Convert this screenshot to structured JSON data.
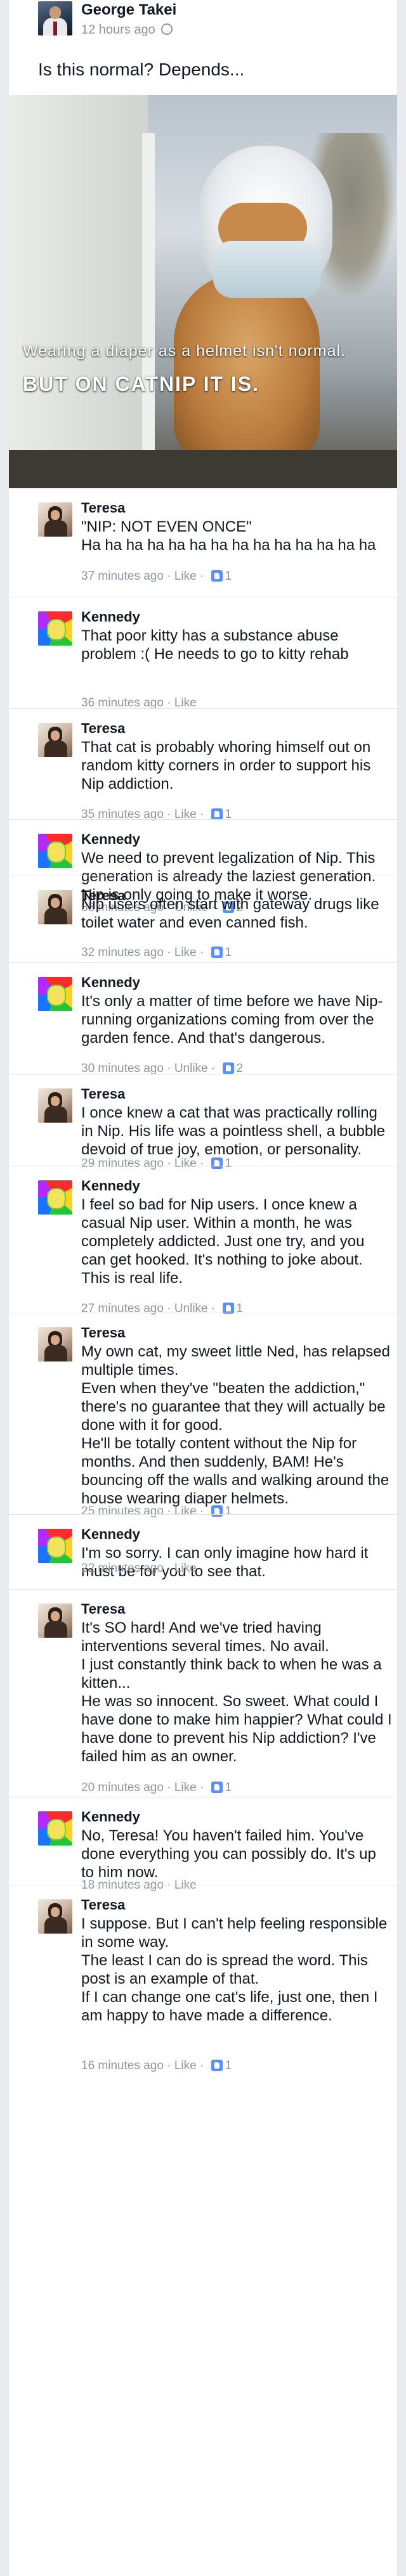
{
  "post": {
    "author": "George Takei",
    "time": "12 hours ago",
    "globe_icon": "globe-icon",
    "text": "Is this normal? Depends...",
    "image_caption_1": "Wearing a diaper as a helmet isn't normal.",
    "image_caption_2": "BUT ON CATNIP IT IS."
  },
  "comments": [
    {
      "author": "Teresa",
      "text": "\"NIP: NOT EVEN ONCE\"\nHa ha ha ha ha ha ha ha ha ha ha ha ha ha",
      "time": "37 minutes ago",
      "action": "Like",
      "likes": "1"
    },
    {
      "author": "Kennedy",
      "text": "That poor kitty has a substance abuse problem :( He needs to go to kitty rehab",
      "time": "36 minutes ago",
      "action": "Like",
      "likes": ""
    },
    {
      "author": "Teresa",
      "text": "That cat is probably whoring himself out on random kitty corners in order to support his Nip addiction.",
      "time": "35 minutes ago",
      "action": "Like",
      "likes": "1"
    },
    {
      "author": "Kennedy",
      "text": "We need to prevent legalization of Nip. This generation is already the laziest generation. Nip is only going to make it worse.",
      "time": "33 minutes ago",
      "action": "Unlike",
      "likes": "2"
    },
    {
      "author": "Teresa",
      "text": "Nip users often start with gateway drugs like toilet water and even canned fish.",
      "time": "32 minutes ago",
      "action": "Like",
      "likes": "1"
    },
    {
      "author": "Kennedy",
      "text": "It's only a matter of time before we have Nip-running organizations coming from over the garden fence. And that's dangerous.",
      "time": "30 minutes ago",
      "action": "Unlike",
      "likes": "2"
    },
    {
      "author": "Teresa",
      "text": "I once knew a cat that was practically rolling in Nip. His life was a pointless shell, a bubble devoid of true joy, emotion, or personality.",
      "time": "29 minutes ago",
      "action": "Like",
      "likes": "1"
    },
    {
      "author": "Kennedy",
      "text": "I feel so bad for Nip users. I once knew a casual Nip user. Within a month, he was completely addicted. Just one try, and you can get hooked. It's nothing to joke about. This is real life.",
      "time": "27 minutes ago",
      "action": "Unlike",
      "likes": "1"
    },
    {
      "author": "Teresa",
      "text": "My own cat, my sweet little Ned, has relapsed multiple times.\nEven when they've \"beaten the addiction,\" there's no guarantee that they will actually be done with it for good.\nHe'll be totally content without the Nip for months. And then suddenly, BAM! He's bouncing off the walls and walking around the house wearing diaper helmets.",
      "time": "25 minutes ago",
      "action": "Like",
      "likes": "1"
    },
    {
      "author": "Kennedy",
      "text": "I'm so sorry. I can only imagine how hard it must be for you to see that.",
      "time": "22 minutes ago",
      "action": "Like",
      "likes": ""
    },
    {
      "author": "Teresa",
      "text": "It's SO hard! And we've tried having interventions several times. No avail.\nI just constantly think back to when he was a kitten...\nHe was so innocent. So sweet. What could I have done to make him happier? What could I have done to prevent his Nip addiction? I've failed him as an owner.",
      "time": "20 minutes ago",
      "action": "Like",
      "likes": "1"
    },
    {
      "author": "Kennedy",
      "text": "No, Teresa! You haven't failed him. You've done everything you can possibly do. It's up to him now.",
      "time": "18 minutes ago",
      "action": "Like",
      "likes": ""
    },
    {
      "author": "Teresa",
      "text": "I suppose. But I can't help feeling responsible in some way.\nThe least I can do is spread the word. This post is an example of that.\nIf I can change one cat's life, just one, then I am happy to have made a difference.",
      "time": "16 minutes ago",
      "action": "Like",
      "likes": "1"
    }
  ],
  "separator": " · "
}
